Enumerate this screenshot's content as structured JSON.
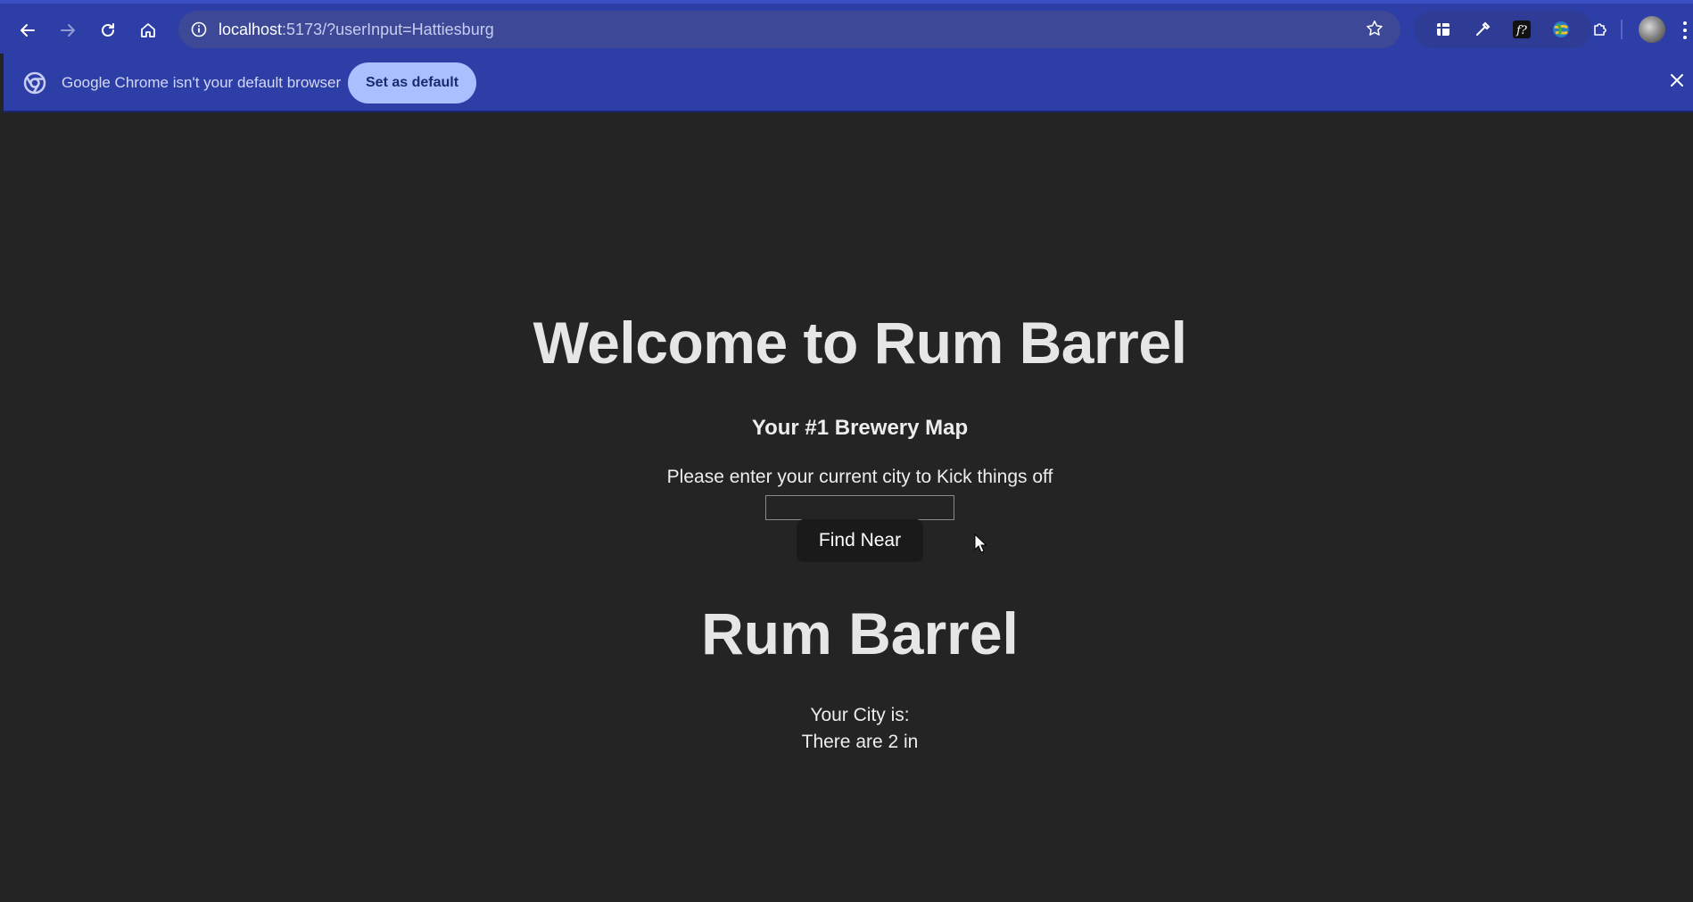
{
  "browser": {
    "url_host": "localhost",
    "url_rest": ":5173/?userInput=Hattiesburg",
    "icons": {
      "back": "back-arrow-icon",
      "forward": "forward-arrow-icon",
      "reload": "reload-icon",
      "home": "home-icon",
      "site_info": "info-icon",
      "bookmark": "star-icon",
      "menu": "kebab-menu-icon"
    },
    "extensions": [
      "toolbox-extension-icon",
      "eyedropper-extension-icon",
      "formula-extension-icon",
      "globe-extension-icon",
      "puzzle-extensions-icon"
    ]
  },
  "infobar": {
    "message": "Google Chrome isn't your default browser",
    "button_label": "Set as default",
    "close_icon": "close-icon"
  },
  "page": {
    "welcome_title": "Welcome to Rum Barrel",
    "subtitle": "Your #1 Brewery Map",
    "prompt": "Please enter your current city to Kick things off",
    "input_value": "",
    "find_button": "Find Near",
    "brand_title": "Rum Barrel",
    "city_label": "Your City is:",
    "count_text": "There are 2 in"
  },
  "colors": {
    "toolbar_bg": "#2d3ea6",
    "page_bg": "#242424",
    "infobar_button_bg": "#a8c0ff",
    "find_button_bg": "#1a1a1a"
  }
}
